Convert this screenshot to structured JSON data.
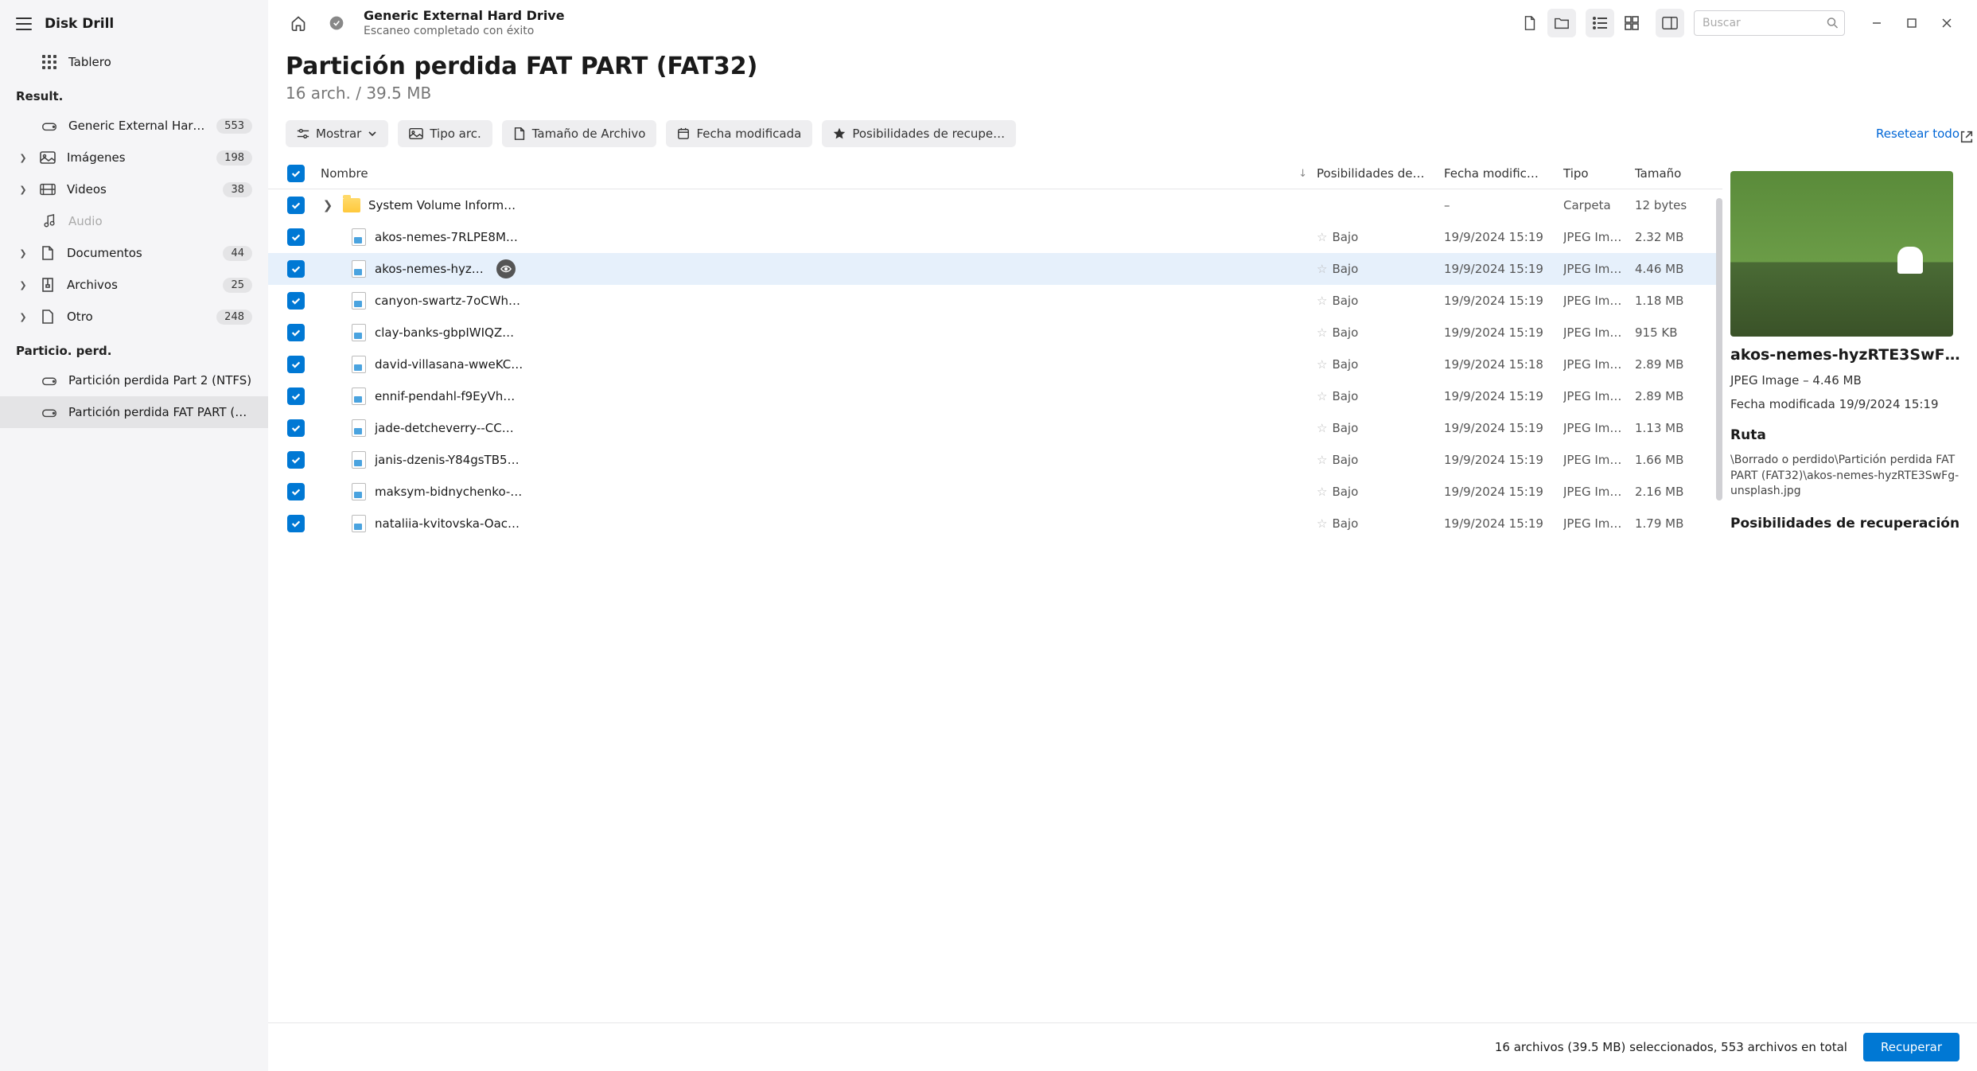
{
  "app": {
    "title": "Disk Drill"
  },
  "sidebar": {
    "dashboard_label": "Tablero",
    "section_results": "Result.",
    "section_partitions": "Particio. perd.",
    "items": [
      {
        "label": "Generic External Hard Dr…",
        "count": "553",
        "icon": "drive"
      },
      {
        "label": "Imágenes",
        "count": "198",
        "icon": "image",
        "expandable": true
      },
      {
        "label": "Videos",
        "count": "38",
        "icon": "video",
        "expandable": true
      },
      {
        "label": "Audio",
        "count": "",
        "icon": "audio",
        "muted": true
      },
      {
        "label": "Documentos",
        "count": "44",
        "icon": "doc",
        "expandable": true
      },
      {
        "label": "Archivos",
        "count": "25",
        "icon": "archive",
        "expandable": true
      },
      {
        "label": "Otro",
        "count": "248",
        "icon": "other",
        "expandable": true
      }
    ],
    "partitions": [
      {
        "label": "Partición perdida Part 2 (NTFS)"
      },
      {
        "label": "Partición perdida FAT PART (F…",
        "selected": true
      }
    ]
  },
  "topbar": {
    "drive_name": "Generic External Hard Drive",
    "drive_status": "Escaneo completado con éxito",
    "search_placeholder": "Buscar"
  },
  "page": {
    "title": "Partición perdida FAT PART (FAT32)",
    "subtitle": "16 arch. / 39.5 MB"
  },
  "filters": {
    "show": "Mostrar",
    "file_type": "Tipo arc.",
    "file_size": "Tamaño de Archivo",
    "modified": "Fecha modificada",
    "chances": "Posibilidades de recupe…",
    "reset": "Resetear todo"
  },
  "columns": {
    "name": "Nombre",
    "chances": "Posibilidades de…",
    "modified": "Fecha modific…",
    "type": "Tipo",
    "size": "Tamaño"
  },
  "rows": [
    {
      "kind": "folder",
      "name": "System Volume Inform…",
      "chances": "",
      "date": "–",
      "type": "Carpeta",
      "size": "12 bytes"
    },
    {
      "kind": "file",
      "name": "akos-nemes-7RLPE8M…",
      "chances": "Bajo",
      "date": "19/9/2024 15:19",
      "type": "JPEG Im…",
      "size": "2.32 MB"
    },
    {
      "kind": "file",
      "name": "akos-nemes-hyz…",
      "chances": "Bajo",
      "date": "19/9/2024 15:19",
      "type": "JPEG Im…",
      "size": "4.46 MB",
      "selected": true,
      "eye": true
    },
    {
      "kind": "file",
      "name": "canyon-swartz-7oCWh…",
      "chances": "Bajo",
      "date": "19/9/2024 15:19",
      "type": "JPEG Im…",
      "size": "1.18 MB"
    },
    {
      "kind": "file",
      "name": "clay-banks-gbpIWIQZ…",
      "chances": "Bajo",
      "date": "19/9/2024 15:19",
      "type": "JPEG Im…",
      "size": "915 KB"
    },
    {
      "kind": "file",
      "name": "david-villasana-wweKC…",
      "chances": "Bajo",
      "date": "19/9/2024 15:18",
      "type": "JPEG Im…",
      "size": "2.89 MB"
    },
    {
      "kind": "file",
      "name": "ennif-pendahl-f9EyVh…",
      "chances": "Bajo",
      "date": "19/9/2024 15:19",
      "type": "JPEG Im…",
      "size": "2.89 MB"
    },
    {
      "kind": "file",
      "name": "jade-detcheverry--CC…",
      "chances": "Bajo",
      "date": "19/9/2024 15:19",
      "type": "JPEG Im…",
      "size": "1.13 MB"
    },
    {
      "kind": "file",
      "name": "janis-dzenis-Y84gsTB5…",
      "chances": "Bajo",
      "date": "19/9/2024 15:19",
      "type": "JPEG Im…",
      "size": "1.66 MB"
    },
    {
      "kind": "file",
      "name": "maksym-bidnychenko-…",
      "chances": "Bajo",
      "date": "19/9/2024 15:19",
      "type": "JPEG Im…",
      "size": "2.16 MB"
    },
    {
      "kind": "file",
      "name": "nataliia-kvitovska-Oac…",
      "chances": "Bajo",
      "date": "19/9/2024 15:19",
      "type": "JPEG Im…",
      "size": "1.79 MB"
    }
  ],
  "preview": {
    "title": "akos-nemes-hyzRTE3SwF…",
    "meta": "JPEG Image – 4.46 MB",
    "modified": "Fecha modificada 19/9/2024 15:19",
    "path_label": "Ruta",
    "path": "\\Borrado o perdido\\Partición perdida FAT PART (FAT32)\\akos-nemes-hyzRTE3SwFg-unsplash.jpg",
    "chances_label": "Posibilidades de recuperación"
  },
  "footer": {
    "summary": "16 archivos (39.5 MB) seleccionados, 553 archivos en total",
    "recover": "Recuperar"
  }
}
